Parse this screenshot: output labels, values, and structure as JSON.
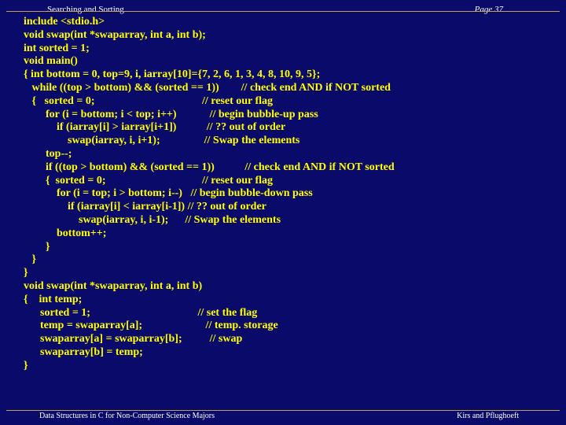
{
  "header": {
    "title": "Searching and Sorting",
    "page": "Page 37"
  },
  "code": "include <stdio.h>\nvoid swap(int *swaparray, int a, int b);\nint sorted = 1;\nvoid main()\n{ int bottom = 0, top=9, i, iarray[10]={7, 2, 6, 1, 3, 4, 8, 10, 9, 5};\n   while ((top > bottom) && (sorted == 1))        // check end AND if NOT sorted\n   {   sorted = 0;                                       // reset our flag\n        for (i = bottom; i < top; i++)            // begin bubble-up pass\n            if (iarray[i] > iarray[i+1])           // ?? out of order\n                swap(iarray, i, i+1);                // Swap the elements\n        top--;\n        if ((top > bottom) && (sorted == 1))           // check end AND if NOT sorted\n        {  sorted = 0;                                   // reset our flag\n            for (i = top; i > bottom; i--)   // begin bubble-down pass\n                if (iarray[i] < iarray[i-1]) // ?? out of order\n                    swap(iarray, i, i-1);      // Swap the elements\n            bottom++;\n        }\n   }\n}\nvoid swap(int *swaparray, int a, int b)\n{    int temp;\n      sorted = 1;                                       // set the flag\n      temp = swaparray[a];                       // temp. storage\n      swaparray[a] = swaparray[b];          // swap\n      swaparray[b] = temp;\n}",
  "footer": {
    "left": "Data Structures in C for Non-Computer Science Majors",
    "right": "Kirs and Pflughoeft"
  }
}
